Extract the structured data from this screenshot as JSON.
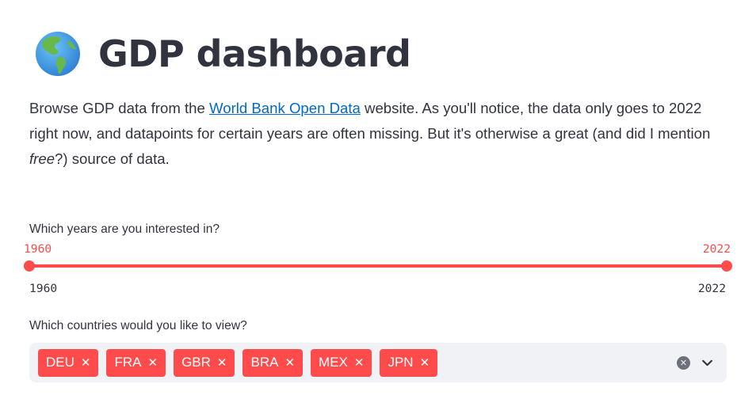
{
  "header": {
    "globe_icon": "globe-americas-icon",
    "title": "GDP dashboard"
  },
  "intro": {
    "text_before_link": "Browse GDP data from the ",
    "link_text": "World Bank Open Data",
    "text_after_link": " website. As you'll notice, the data only goes to 2022 right now, and datapoints for certain years are often missing. But it's otherwise a great (and did I mention ",
    "italic_text": "free",
    "text_end": "?) source of data."
  },
  "year_slider": {
    "label": "Which years are you interested in?",
    "selected_min": "1960",
    "selected_max": "2022",
    "range_min": "1960",
    "range_max": "2022",
    "accent_color": "#ff4b4b"
  },
  "country_select": {
    "label": "Which countries would you like to view?",
    "chips": [
      {
        "label": "DEU",
        "remove": "✕"
      },
      {
        "label": "FRA",
        "remove": "✕"
      },
      {
        "label": "GBR",
        "remove": "✕"
      },
      {
        "label": "BRA",
        "remove": "✕"
      },
      {
        "label": "MEX",
        "remove": "✕"
      },
      {
        "label": "JPN",
        "remove": "✕"
      }
    ],
    "clear_icon": "clear-circle-icon",
    "clear_glyph": "✕",
    "dropdown_icon": "chevron-down-icon",
    "chip_color": "#ff4b4b",
    "box_color": "#f0f2f6"
  }
}
